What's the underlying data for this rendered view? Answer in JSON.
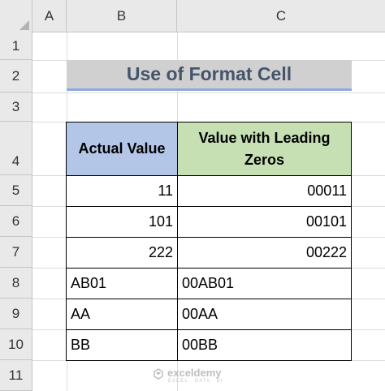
{
  "columns": [
    "A",
    "B",
    "C"
  ],
  "rows": [
    "1",
    "2",
    "3",
    "4",
    "5",
    "6",
    "7",
    "8",
    "9",
    "10",
    "11"
  ],
  "title": "Use of Format Cell",
  "table": {
    "header_actual": "Actual Value",
    "header_leading": "Value with Leading Zeros",
    "rows": [
      {
        "actual": "11",
        "leading": "00011"
      },
      {
        "actual": "101",
        "leading": "00101"
      },
      {
        "actual": "222",
        "leading": "00222"
      },
      {
        "actual": "AB01",
        "leading": "00AB01"
      },
      {
        "actual": "AA",
        "leading": "00AA"
      },
      {
        "actual": "BB",
        "leading": "00BB"
      }
    ]
  },
  "watermark": {
    "name": "exceldemy",
    "tagline": "EXCEL · DATA · BI"
  },
  "colors": {
    "header_actual_fill": "#b4c6e7",
    "header_leading_fill": "#c6e0b4",
    "title_fill": "#d0d0d0",
    "title_text": "#44546a",
    "title_underline": "#8ea9db"
  }
}
